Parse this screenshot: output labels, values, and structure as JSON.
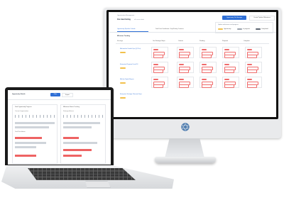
{
  "monitor": {
    "screen": {
      "breadcrumb": "Opportunities Management",
      "title": "Our deal listing",
      "subtitle": "all current deals",
      "primary_button": "Opportunity Tile Manager",
      "secondary_button": "Create Pipeline Milestones",
      "tabs": [
        "Opportunity Pipeline Outlook",
        "Deal Data Dashboard - Key/Priority Contacts"
      ],
      "info_line": "Update milestones and progress",
      "board_header": "Milestone Tracking",
      "columns": [
        "Our Strategic Steps",
        "Contact",
        "Pending",
        "Proposal",
        "Complete"
      ],
      "lane_title": "No stage",
      "rows": [
        {
          "name": "Mid-market Scaled Ops (Q2 Pro)",
          "tag": "In progress"
        },
        {
          "name": "Enterprise Regional Lead 24",
          "tag": "Review"
        },
        {
          "name": "Mid-tier Digital Buyers",
          "tag": "Pending"
        },
        {
          "name": "Enterprise Strategic Renewal Sync",
          "tag": "Review"
        }
      ],
      "filter_legend": [
        "Opportunity",
        "In progress",
        "Completed"
      ],
      "colors": {
        "accent": "#2f6fd6",
        "alert": "#ef6b6b",
        "highlight": "#f2c04b"
      }
    }
  },
  "laptop": {
    "screen": {
      "title": "Opportunity Details",
      "buttons": [
        "Filter",
        "Export"
      ],
      "panels": [
        {
          "heading": "Deal Opportunity Progress"
        },
        {
          "heading": "Milestone Status Tracking"
        }
      ],
      "section_labels": [
        "Current Opportunities",
        "Deal Breakdown",
        "Strategic Actions"
      ]
    }
  }
}
